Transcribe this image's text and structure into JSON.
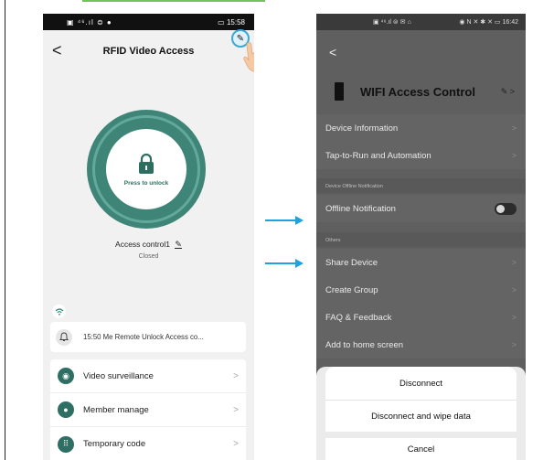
{
  "left_phone": {
    "status": {
      "time": "15:58",
      "left_icons": "▣ ⁴⁶.ıl ⊜ ●",
      "battery": "▭"
    },
    "header": {
      "back": "<",
      "title": "RFID Video Access",
      "edit_glyph": "✎"
    },
    "lock": {
      "label": "Press to unlock"
    },
    "access": {
      "name": "Access control1",
      "edit_glyph": "✎",
      "status": "Closed"
    },
    "notification": {
      "text": "15:50 Me  Remote Unlock Access co..."
    },
    "menu": [
      {
        "label": "Video surveillance",
        "icon": "camera-icon",
        "glyph": "◉"
      },
      {
        "label": "Member manage",
        "icon": "person-icon",
        "glyph": "●"
      },
      {
        "label": "Temporary code",
        "icon": "keypad-icon",
        "glyph": "⠿"
      }
    ],
    "chevron": ">"
  },
  "right_phone": {
    "status": {
      "time": "16:42",
      "left_icons": "▣ ⁴⁶.ıl ⊜ ✉ ⌂",
      "right_icons": "◉ N ✕ ✱ ✕ ▭"
    },
    "back": "<",
    "device": {
      "title": "WIFI Access Control",
      "edit_glyph": "✎ >"
    },
    "rows_top": [
      {
        "label": "Device Information"
      },
      {
        "label": "Tap-to-Run and Automation"
      }
    ],
    "section_offline": "Device Offline Notification",
    "offline_row": {
      "label": "Offline Notification"
    },
    "section_others": "Others",
    "rows_others": [
      {
        "label": "Share Device"
      },
      {
        "label": "Create Group"
      },
      {
        "label": "FAQ & Feedback"
      },
      {
        "label": "Add to home screen"
      }
    ],
    "chevron": ">",
    "sheet": {
      "disconnect": "Disconnect",
      "disconnect_wipe": "Disconnect and wipe data",
      "cancel": "Cancel"
    }
  },
  "colors": {
    "accent_teal": "#3f8577",
    "arrow_blue": "#1fa3e0",
    "highlight_ring": "#3aa8d8"
  }
}
